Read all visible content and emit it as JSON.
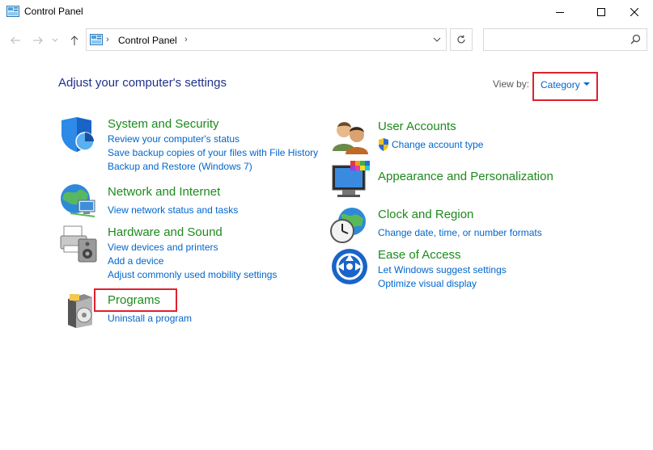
{
  "window": {
    "title": "Control Panel",
    "icon": "control-panel-icon",
    "minimize_icon": "minimize-icon",
    "maximize_icon": "maximize-icon",
    "close_icon": "close-icon"
  },
  "address_bar": {
    "path": [
      "Control Panel"
    ],
    "separator": "›",
    "search_placeholder": ""
  },
  "main": {
    "heading": "Adjust your computer's settings",
    "view_by_label": "View by:",
    "view_by_value": "Category"
  },
  "categories": [
    {
      "title": "System and Security",
      "icon": "shield-icon",
      "links": [
        "Review your computer's status",
        "Save backup copies of your files with File History",
        "Backup and Restore (Windows 7)"
      ]
    },
    {
      "title": "Network and Internet",
      "icon": "network-globe-icon",
      "links": [
        "View network status and tasks"
      ]
    },
    {
      "title": "Hardware and Sound",
      "icon": "printer-speaker-icon",
      "links": [
        "View devices and printers",
        "Add a device",
        "Adjust commonly used mobility settings"
      ]
    },
    {
      "title": "Programs",
      "icon": "programs-disc-icon",
      "links": [
        "Uninstall a program"
      ]
    },
    {
      "title": "User Accounts",
      "icon": "users-icon",
      "links": [
        "Change account type"
      ],
      "link_icon": "uac-shield-icon"
    },
    {
      "title": "Appearance and Personalization",
      "icon": "monitor-palette-icon",
      "links": []
    },
    {
      "title": "Clock and Region",
      "icon": "clock-globe-icon",
      "links": [
        "Change date, time, or number formats"
      ]
    },
    {
      "title": "Ease of Access",
      "icon": "ease-of-access-icon",
      "links": [
        "Let Windows suggest settings",
        "Optimize visual display"
      ]
    }
  ],
  "colors": {
    "category_title": "#1d8a1d",
    "link": "#0066cc",
    "heading": "#1e3287",
    "highlight": "#e0202e"
  }
}
